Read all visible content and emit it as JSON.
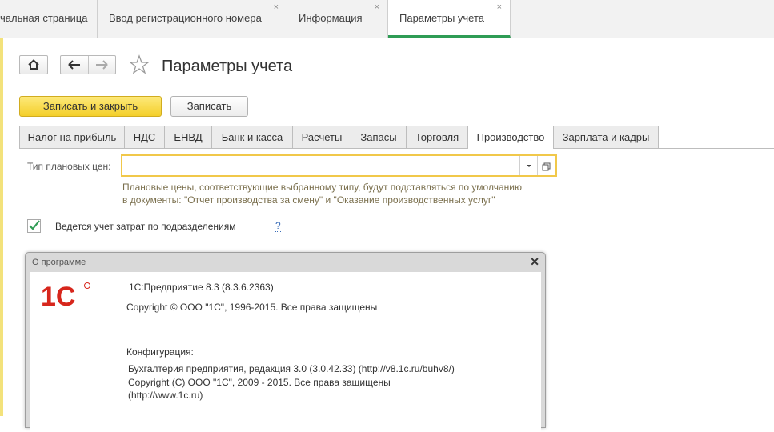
{
  "window_tabs": [
    {
      "label": "чальная страница",
      "closable": false
    },
    {
      "label": "Ввод регистрационного номера",
      "closable": true,
      "close": "×"
    },
    {
      "label": "Информация",
      "closable": true,
      "close": "×"
    },
    {
      "label": "Параметры учета",
      "closable": true,
      "close": "×",
      "active": true
    }
  ],
  "page": {
    "title": "Параметры учета"
  },
  "toolbar": {
    "save_close_label": "Записать и закрыть",
    "save_label": "Записать"
  },
  "form_tabs": [
    "Налог на прибыль",
    "НДС",
    "ЕНВД",
    "Банк и касса",
    "Расчеты",
    "Запасы",
    "Торговля",
    "Производство",
    "Зарплата и кадры"
  ],
  "active_form_tab": "Производство",
  "planned_price": {
    "label": "Тип плановых цен:",
    "value": "",
    "hint_line1": "Плановые цены, соответствующие выбранному типу, будут подставляться по умолчанию",
    "hint_line2": "в документы: \"Отчет производства за смену\" и \"Оказание производственных услуг\""
  },
  "cost_by_division": {
    "label": "Ведется учет затрат по подразделениям",
    "checked": true,
    "help": "?"
  },
  "about": {
    "title": "О программе",
    "close": "✕",
    "logo_text": "1С",
    "product": "1С:Предприятие 8.3 (8.3.6.2363)",
    "copyright": "Copyright © ООО \"1С\", 1996-2015. Все права защищены",
    "config_label": "Конфигурация:",
    "config_line1": "Бухгалтерия предприятия, редакция 3.0 (3.0.42.33) (http://v8.1c.ru/buhv8/)",
    "config_line2": "Copyright (С) ООО \"1С\", 2009 - 2015. Все права защищены",
    "config_line3": "(http://www.1c.ru)"
  },
  "colors": {
    "accent_green": "#2f9c55",
    "primary_button": "#f4cf2a",
    "brand_red": "#d7261c"
  }
}
